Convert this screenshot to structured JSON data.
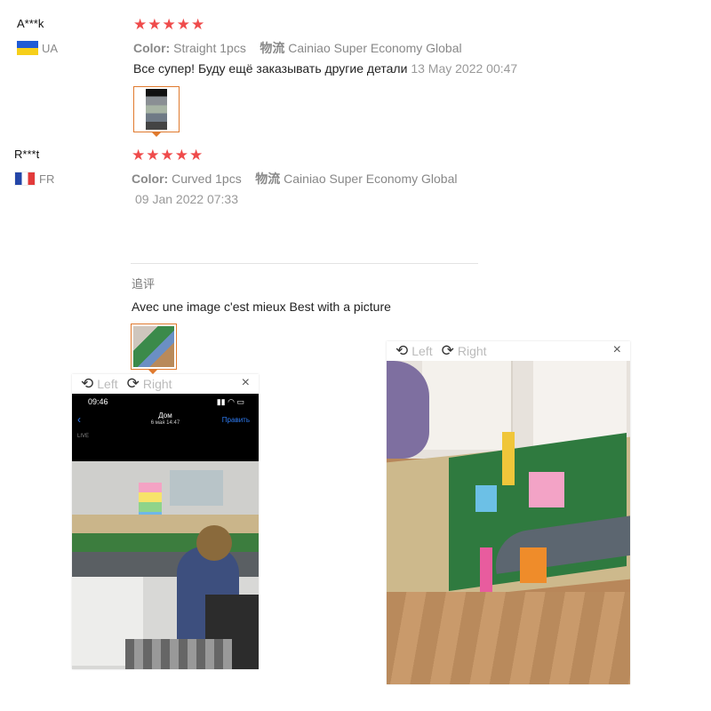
{
  "reviews": [
    {
      "user": "A***k",
      "country": "UA",
      "stars": "★★★★★",
      "color_label": "Color:",
      "color_value": "Straight 1pcs",
      "shipping_label": "物流",
      "shipping_value": "Cainiao Super Economy Global",
      "text": "Все супер! Буду ещё заказывать другие детали",
      "date": "13 May 2022 00:47"
    },
    {
      "user": "R***t",
      "country": "FR",
      "stars": "★★★★★",
      "color_label": "Color:",
      "color_value": "Curved 1pcs",
      "shipping_label": "物流",
      "shipping_value": "Cainiao Super Economy Global",
      "date": "09 Jan 2022 07:33",
      "followup_label": "追评",
      "followup_text": "Avec une image c'est mieux Best with a picture"
    }
  ],
  "viewer": {
    "rotate_left": "Left",
    "rotate_right": "Right",
    "close": "×"
  },
  "phone_screen": {
    "time": "09:46",
    "title": "Дом",
    "subtitle": "6 мая 14:47",
    "edit": "Править",
    "live": "LIVE"
  },
  "colors": {
    "star": "#ef4b4b",
    "thumb_border": "#e07a2e",
    "meta_text": "#888888"
  }
}
